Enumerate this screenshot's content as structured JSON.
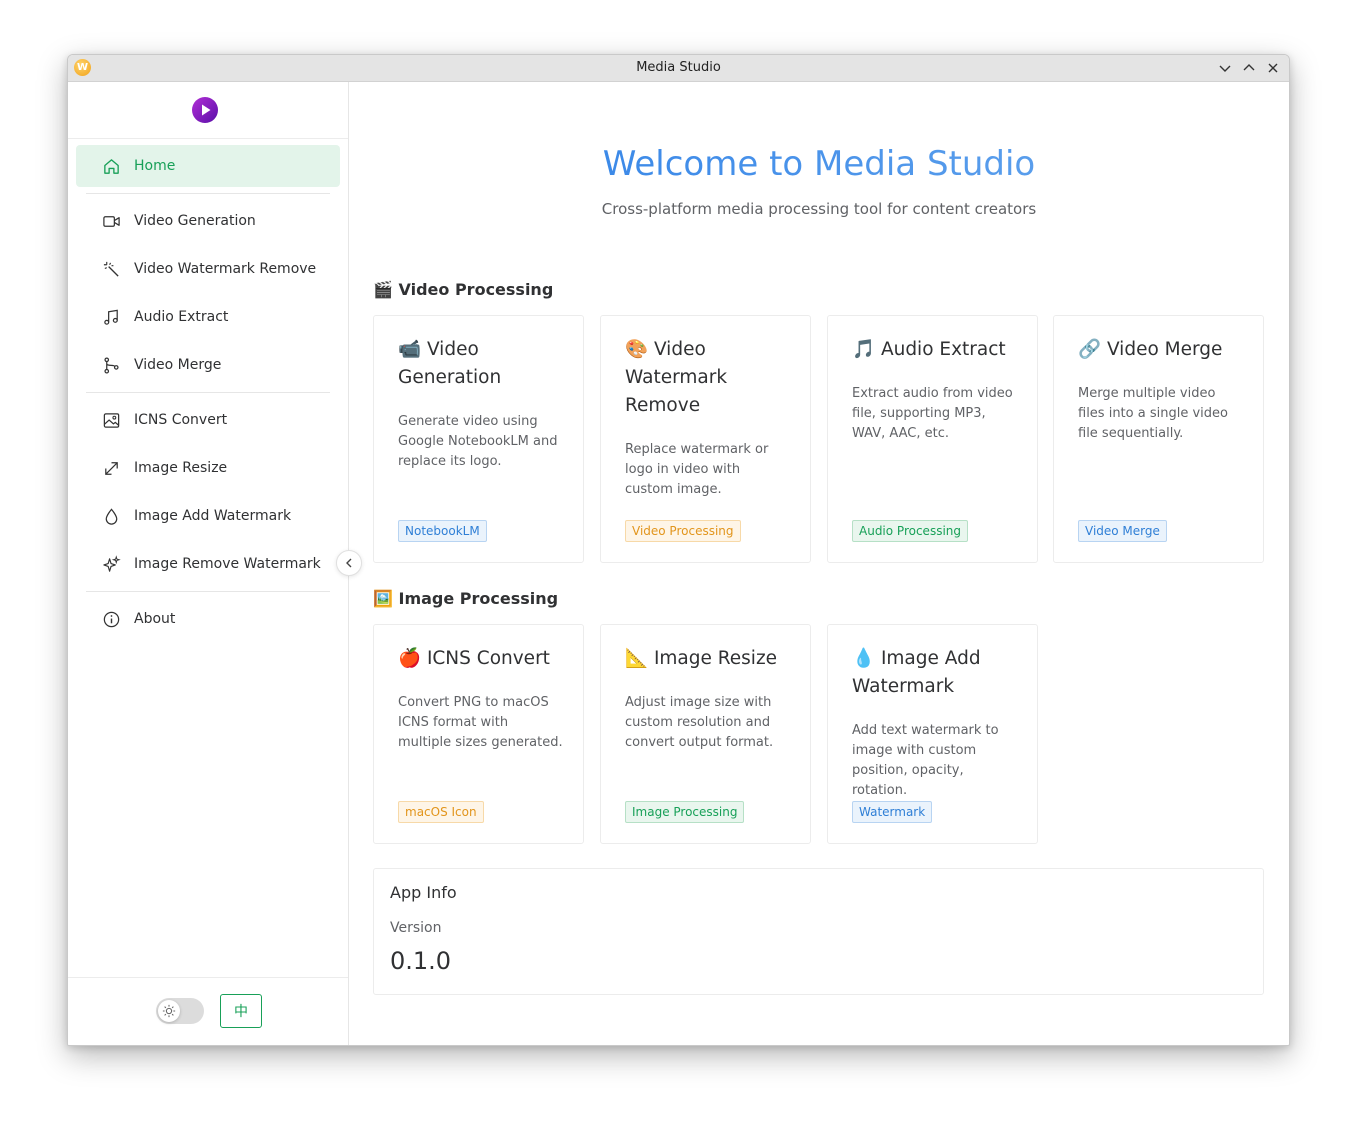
{
  "window": {
    "title": "Media Studio",
    "app_icon_letter": "W"
  },
  "sidebar": {
    "items": [
      {
        "label": "Home",
        "icon": "home-icon",
        "active": true
      },
      {
        "label": "Video Generation",
        "icon": "video-camera-icon"
      },
      {
        "label": "Video Watermark Remove",
        "icon": "magic-wand-icon"
      },
      {
        "label": "Audio Extract",
        "icon": "music-note-icon"
      },
      {
        "label": "Video Merge",
        "icon": "merge-icon"
      },
      {
        "label": "ICNS Convert",
        "icon": "image-icon"
      },
      {
        "label": "Image Resize",
        "icon": "resize-arrow-icon"
      },
      {
        "label": "Image Add Watermark",
        "icon": "droplet-icon"
      },
      {
        "label": "Image Remove Watermark",
        "icon": "sparkles-icon"
      },
      {
        "label": "About",
        "icon": "info-icon"
      }
    ],
    "lang_button": "中"
  },
  "main": {
    "welcome": "Welcome to Media Studio",
    "subtitle": "Cross-platform media processing tool for content creators",
    "sections": [
      {
        "emoji": "🎬",
        "title": "Video Processing",
        "cards": [
          {
            "emoji": "📹",
            "title": "Video Generation",
            "desc": "Generate video using Google NotebookLM and replace its logo.",
            "tag": "NotebookLM",
            "tag_color": "blue"
          },
          {
            "emoji": "🎨",
            "title": "Video Watermark Remove",
            "desc": "Replace watermark or logo in video with custom image.",
            "tag": "Video Processing",
            "tag_color": "orange"
          },
          {
            "emoji": "🎵",
            "title": "Audio Extract",
            "desc": "Extract audio from video file, supporting MP3, WAV, AAC, etc.",
            "tag": "Audio Processing",
            "tag_color": "green"
          },
          {
            "emoji": "🔗",
            "title": "Video Merge",
            "desc": "Merge multiple video files into a single video file sequentially.",
            "tag": "Video Merge",
            "tag_color": "blue"
          }
        ]
      },
      {
        "emoji": "🖼️",
        "title": "Image Processing",
        "cards": [
          {
            "emoji": "🍎",
            "title": "ICNS Convert",
            "desc": "Convert PNG to macOS ICNS format with multiple sizes generated.",
            "tag": "macOS Icon",
            "tag_color": "orange"
          },
          {
            "emoji": "📐",
            "title": "Image Resize",
            "desc": "Adjust image size with custom resolution and convert output format.",
            "tag": "Image Processing",
            "tag_color": "green"
          },
          {
            "emoji": "💧",
            "title": "Image Add Watermark",
            "desc": "Add text watermark to image with custom position, opacity, rotation.",
            "tag": "Watermark",
            "tag_color": "blue"
          }
        ]
      }
    ],
    "app_info": {
      "title": "App Info",
      "version_label": "Version",
      "version": "0.1.0"
    }
  }
}
